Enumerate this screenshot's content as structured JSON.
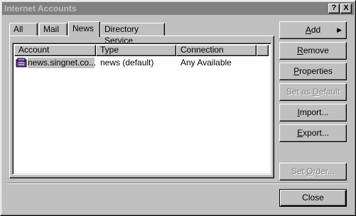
{
  "window": {
    "title": "Internet Accounts",
    "help_glyph": "?",
    "close_glyph": "X"
  },
  "tabs": [
    {
      "label": "All"
    },
    {
      "label": "Mail"
    },
    {
      "label": "News"
    },
    {
      "label": "Directory Service"
    }
  ],
  "list": {
    "columns": [
      "Account",
      "Type",
      "Connection"
    ],
    "rows": [
      {
        "account": "news.singnet.co...",
        "type": "news (default)",
        "connection": "Any Available"
      }
    ]
  },
  "buttons": {
    "add": {
      "pre": "",
      "accel": "A",
      "post": "dd",
      "arrow": "▶"
    },
    "remove": {
      "pre": "",
      "accel": "R",
      "post": "emove"
    },
    "properties": {
      "pre": "",
      "accel": "P",
      "post": "roperties"
    },
    "set_default": {
      "pre": "Set as ",
      "accel": "D",
      "post": "efault"
    },
    "import": {
      "pre": "",
      "accel": "I",
      "post": "mport..."
    },
    "export": {
      "pre": "",
      "accel": "E",
      "post": "xport..."
    },
    "set_order": {
      "pre": "Set ",
      "accel": "O",
      "post": "rder..."
    },
    "close": "Close"
  },
  "colors": {
    "face": "#c0c0c0",
    "title_inactive": "#808080",
    "selection": "#c0c0c0"
  }
}
